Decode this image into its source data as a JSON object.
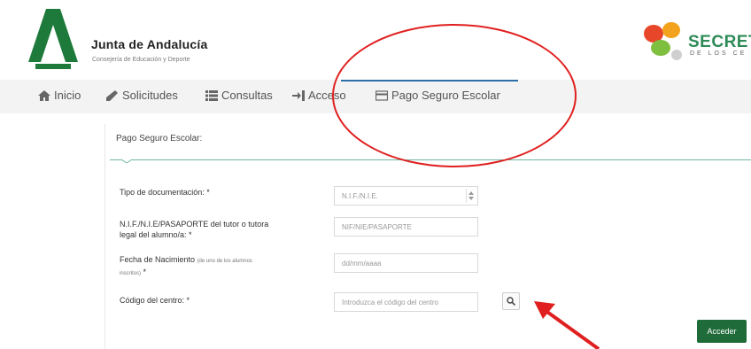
{
  "brand": {
    "title": "Junta de Andalucía",
    "subtitle": "Consejería de Educación y Deporte"
  },
  "secretaria": {
    "title": "SECRET",
    "subtitle": "DE LOS CE"
  },
  "nav": {
    "items": [
      {
        "label": "Inicio",
        "icon": "home-icon"
      },
      {
        "label": "Solicitudes",
        "icon": "pencil-icon"
      },
      {
        "label": "Consultas",
        "icon": "list-icon"
      },
      {
        "label": "Acceso",
        "icon": "sign-in-icon"
      },
      {
        "label": "Pago Seguro Escolar",
        "icon": "credit-card-icon"
      }
    ]
  },
  "panel": {
    "title": "Pago Seguro Escolar:"
  },
  "form": {
    "doc_type_label": "Tipo de documentación: *",
    "doc_type_value": "N.I.F./N.I.E.",
    "doc_number_label_1": "N.I.F./N.I.E/PASAPORTE del tutor o tutora",
    "doc_number_label_2": "legal del alumno/a: *",
    "doc_number_placeholder": "NIF/NIE/PASAPORTE",
    "birth_label_1": "Fecha de Nacimiento",
    "birth_label_hint": "(de uno de los alumnos",
    "birth_label_2": "inscritos)",
    "birth_label_req": " *",
    "birth_placeholder": "dd/mm/aaaa",
    "center_code_label": "Código del centro: *",
    "center_code_placeholder": "Introduzca el código del centro",
    "submit_label": "Acceder"
  },
  "colors": {
    "accent_green": "#1f6b3a",
    "annotation_red": "#e02020",
    "nav_blue": "#2b6ea8"
  }
}
